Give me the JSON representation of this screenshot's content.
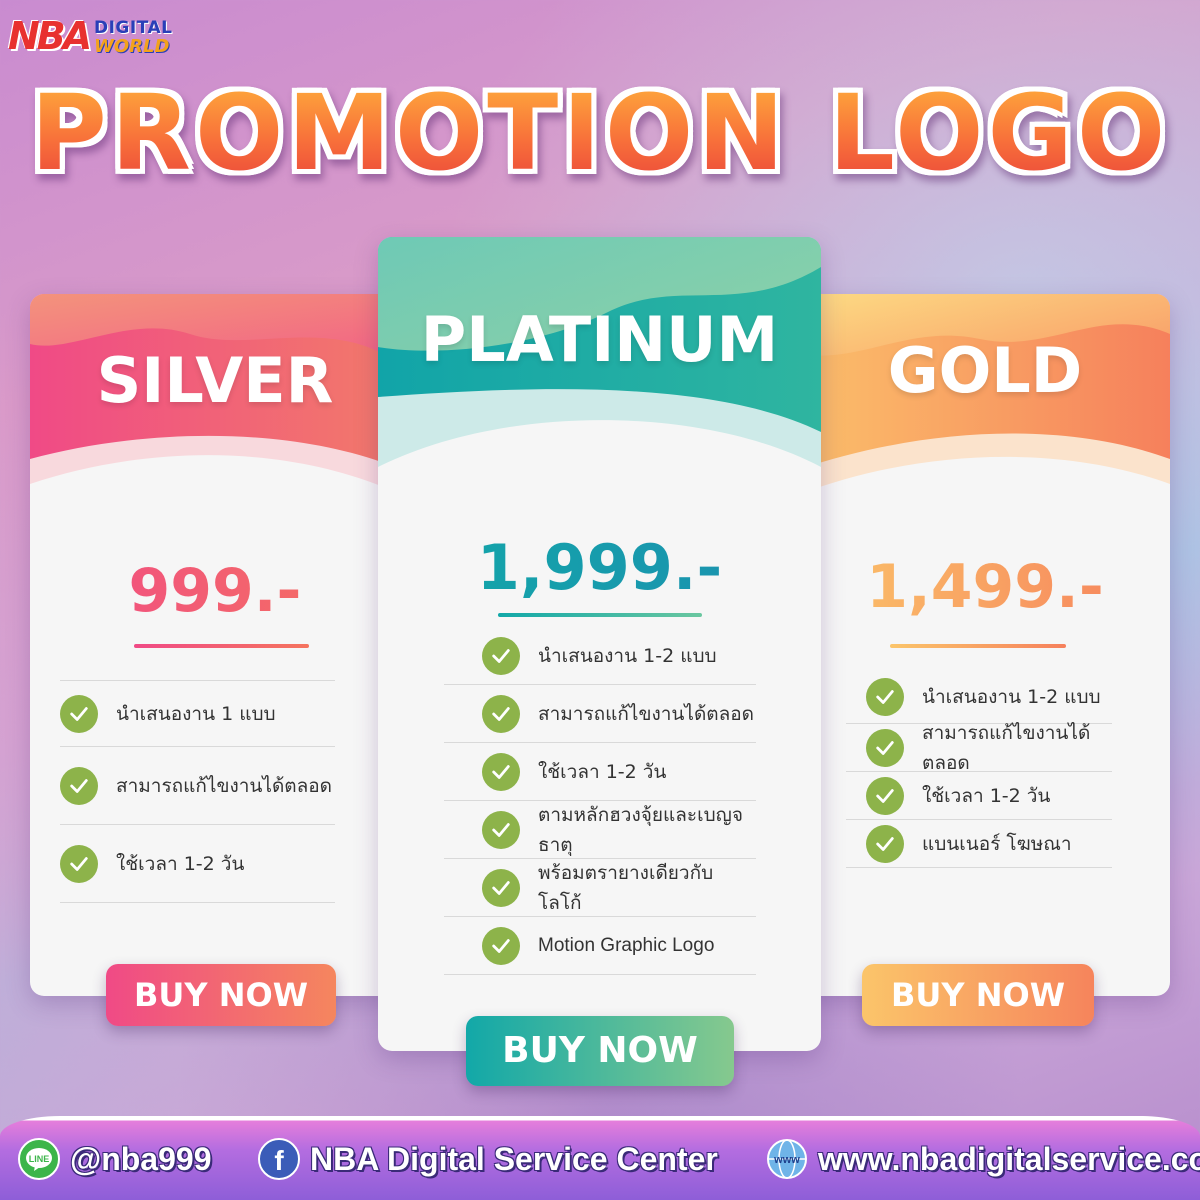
{
  "brand": {
    "nba": "NBA",
    "digital": "DIGITAL",
    "world": "WORLD"
  },
  "title": "PROMOTION LOGO",
  "plans": {
    "silver": {
      "name": "SILVER",
      "price": "999.-",
      "features": [
        "นำเสนองาน 1 แบบ",
        "สามารถแก้ไขงานได้ตลอด",
        "ใช้เวลา 1-2 วัน"
      ],
      "button": "BUY NOW",
      "colors": {
        "start": "#f25c8a",
        "end": "#f58a5a"
      }
    },
    "platinum": {
      "name": "PLATINUM",
      "price": "1,999.-",
      "features": [
        "นำเสนองาน 1-2 แบบ",
        "สามารถแก้ไขงานได้ตลอด",
        "ใช้เวลา 1-2 วัน",
        "ตามหลักฮวงจุ้ยและเบญจธาตุ",
        "พร้อมตรายางเดียวกับโลโก้",
        "Motion Graphic Logo"
      ],
      "button": "BUY NOW",
      "colors": {
        "start": "#12a8a8",
        "end": "#8cc98a"
      }
    },
    "gold": {
      "name": "GOLD",
      "price": "1,499.-",
      "features": [
        "นำเสนองาน 1-2 แบบ",
        "สามารถแก้ไขงานได้ตลอด",
        "ใช้เวลา 1-2 วัน",
        "แบนเนอร์ โฆษณา"
      ],
      "button": "BUY NOW",
      "colors": {
        "start": "#fbc56a",
        "end": "#f6805c"
      }
    }
  },
  "footer": {
    "line_icon_label": "LINE",
    "line_id": "@nba999",
    "facebook_icon_label": "f",
    "facebook_page": "NBA Digital Service Center",
    "web_icon_label": "www",
    "website": "www.nbadigitalservice.com"
  }
}
